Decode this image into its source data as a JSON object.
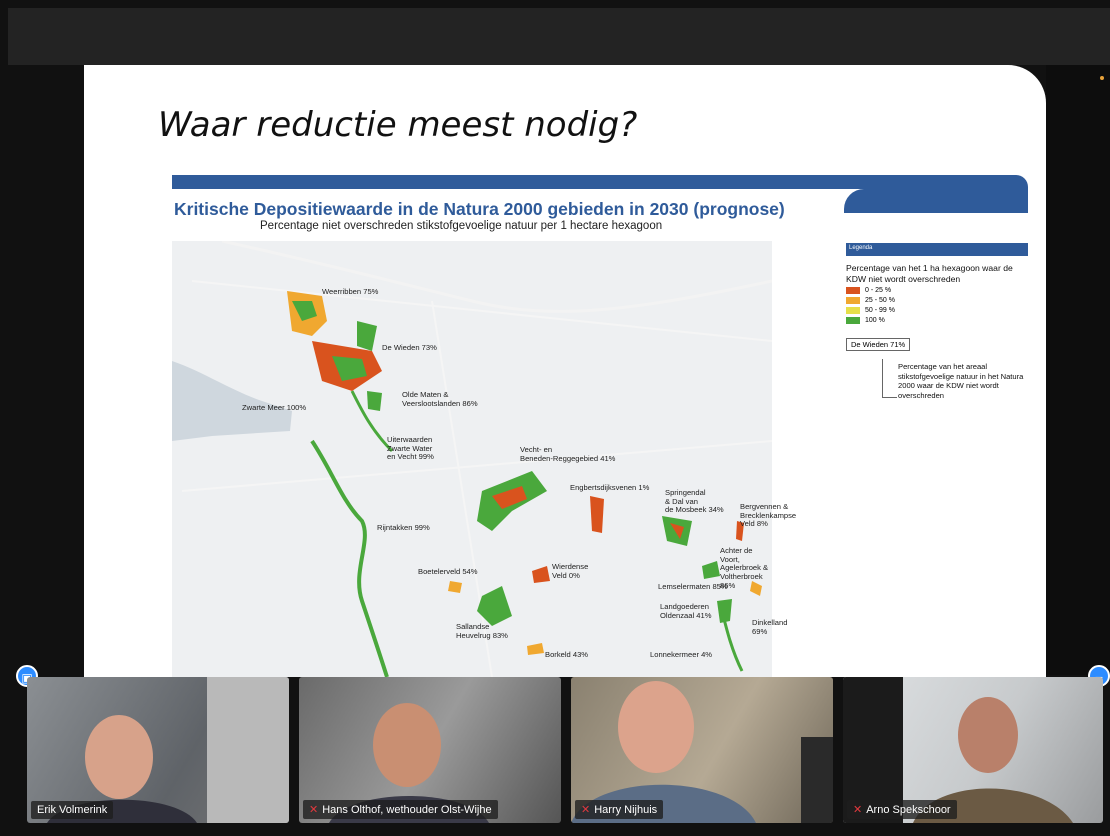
{
  "slide": {
    "title": "Waar reductie meest nodig?",
    "map_title": "Kritische Depositiewaarde in de Natura 2000 gebieden in 2030 (prognose)",
    "map_subtitle": "Percentage niet overschreden stikstofgevoelige natuur per 1 hectare hexagoon"
  },
  "map_labels": [
    "Weerribben 75%",
    "De Wieden 73%",
    "Olde Maten &\nVeerslootslanden 86%",
    "Zwarte Meer 100%",
    "Uiterwaarden\nZwarte Water\nen Vecht 99%",
    "Vecht- en\nBeneden-Reggegebied 41%",
    "Engbertsdijksvenen 1%",
    "Springendal\n& Dal van\nde Mosbeek 34%",
    "Bergvennen &\nBrecklenkampse\nVeld 8%",
    "Rijntakken 99%",
    "Achter de Voort,\nAgelerbroek &\nVoltherbroek 86%",
    "Boetelerveld 54%",
    "Wierdense\nVeld 0%",
    "Lemselermaten 85%",
    "Landgoederen\nOldenzaal 41%",
    "Dinkelland 69%",
    "Sallandse\nHeuvelrug 83%",
    "Borkeld 43%",
    "Lonnekermeer 4%"
  ],
  "legend": {
    "header": "Legenda",
    "description": "Percentage van het 1 ha hexagoon waar de KDW niet wordt overschreden",
    "items": [
      {
        "label": "0 - 25 %",
        "color": "#d9531e"
      },
      {
        "label": "25 - 50 %",
        "color": "#f0a830"
      },
      {
        "label": "50 - 99 %",
        "color": "#e6df4a"
      },
      {
        "label": "100 %",
        "color": "#4aa83c"
      }
    ],
    "example_label": "De Wieden 71%",
    "example_description": "Percentage van het areaal stikstofgevoelige natuur in het Natura 2000 waar de KDW niet wordt overschreden"
  },
  "participants": [
    {
      "name": "Erik Volmerink",
      "muted": false
    },
    {
      "name": "Hans Olthof, wethouder Olst-Wijhe",
      "muted": true
    },
    {
      "name": "Harry Nijhuis",
      "muted": true
    },
    {
      "name": "Arno Spekschoor",
      "muted": true
    }
  ],
  "colors": {
    "accent_blue": "#2f5b9a",
    "zoom_blue": "#2d8cff",
    "muted_red": "#e0393e"
  }
}
